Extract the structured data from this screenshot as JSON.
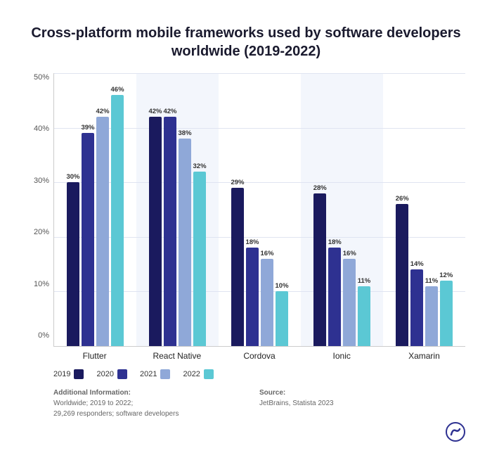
{
  "title": "Cross-platform mobile frameworks used by\nsoftware developers worldwide (2019-2022)",
  "yAxis": {
    "labels": [
      "50%",
      "40%",
      "30%",
      "20%",
      "10%",
      "0%"
    ]
  },
  "xAxis": {
    "labels": [
      "Flutter",
      "React Native",
      "Cordova",
      "Ionic",
      "Xamarin"
    ]
  },
  "legend": [
    {
      "year": "2019",
      "color": "#1a1a5e"
    },
    {
      "year": "2020",
      "color": "#2e3191"
    },
    {
      "year": "2021",
      "color": "#8fa8d8"
    },
    {
      "year": "2022",
      "color": "#5bc8d4"
    }
  ],
  "groups": [
    {
      "name": "Flutter",
      "bars": [
        {
          "value": 30,
          "label": "30%",
          "color": "#1a1a5e"
        },
        {
          "value": 39,
          "label": "39%",
          "color": "#2e3191"
        },
        {
          "value": 42,
          "label": "42%",
          "color": "#8fa8d8"
        },
        {
          "value": 46,
          "label": "46%",
          "color": "#5bc8d4"
        }
      ]
    },
    {
      "name": "React Native",
      "bars": [
        {
          "value": 42,
          "label": "42%",
          "color": "#1a1a5e"
        },
        {
          "value": 42,
          "label": "42%",
          "color": "#2e3191"
        },
        {
          "value": 38,
          "label": "38%",
          "color": "#8fa8d8"
        },
        {
          "value": 32,
          "label": "32%",
          "color": "#5bc8d4"
        }
      ]
    },
    {
      "name": "Cordova",
      "bars": [
        {
          "value": 29,
          "label": "29%",
          "color": "#1a1a5e"
        },
        {
          "value": 18,
          "label": "18%",
          "color": "#2e3191"
        },
        {
          "value": 16,
          "label": "16%",
          "color": "#8fa8d8"
        },
        {
          "value": 10,
          "label": "10%",
          "color": "#5bc8d4"
        }
      ]
    },
    {
      "name": "Ionic",
      "bars": [
        {
          "value": 28,
          "label": "28%",
          "color": "#1a1a5e"
        },
        {
          "value": 18,
          "label": "18%",
          "color": "#2e3191"
        },
        {
          "value": 16,
          "label": "16%",
          "color": "#8fa8d8"
        },
        {
          "value": 11,
          "label": "11%",
          "color": "#5bc8d4"
        }
      ]
    },
    {
      "name": "Xamarin",
      "bars": [
        {
          "value": 26,
          "label": "26%",
          "color": "#1a1a5e"
        },
        {
          "value": 14,
          "label": "14%",
          "color": "#2e3191"
        },
        {
          "value": 11,
          "label": "11%",
          "color": "#8fa8d8"
        },
        {
          "value": 12,
          "label": "12%",
          "color": "#5bc8d4"
        }
      ]
    }
  ],
  "footer": {
    "left_label": "Additional Information:",
    "left_text": "Worldwide; 2019 to 2022;\n29,269 responders; software developers",
    "right_label": "Source:",
    "right_text": "JetBrains, Statista 2023"
  },
  "maxValue": 50
}
